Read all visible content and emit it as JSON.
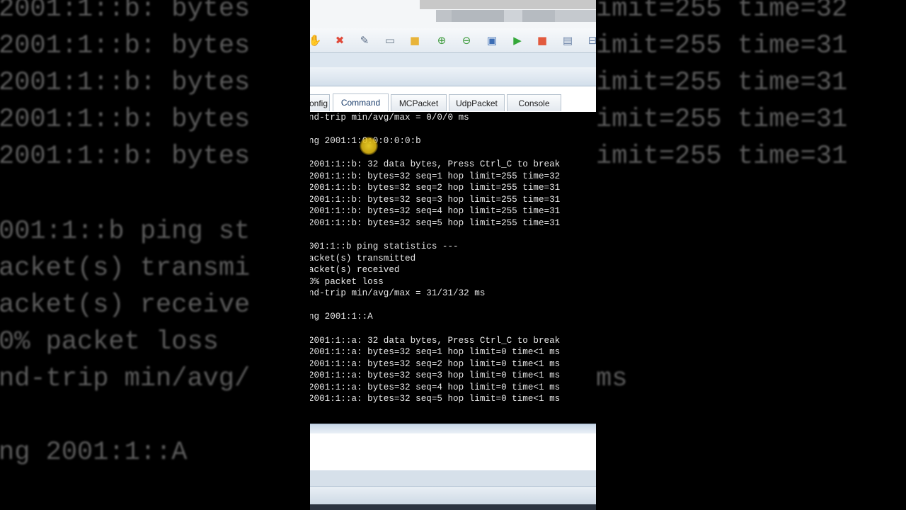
{
  "background": {
    "left_lines": [
      "2001:1::b: bytes",
      "2001:1::b: bytes",
      "2001:1::b: bytes",
      "2001:1::b: bytes",
      "2001:1::b: bytes",
      "",
      "001:1::b ping st",
      "acket(s) transmi",
      "acket(s) receive",
      "0% packet loss",
      "nd-trip min/avg/",
      "",
      "ng 2001:1::A"
    ],
    "right_lines": [
      "imit=255 time=32",
      "imit=255 time=31",
      "imit=255 time=31",
      "imit=255 time=31",
      "imit=255 time=31",
      "",
      "",
      "",
      "",
      "",
      "ms"
    ]
  },
  "toolbar": {
    "buttons": [
      {
        "name": "hand-icon",
        "glyph": "✋",
        "color": "#d98a2b"
      },
      {
        "name": "delete-icon",
        "glyph": "✖",
        "color": "#e04a3a"
      },
      {
        "name": "inspect-icon",
        "glyph": "✎",
        "color": "#5a6c86"
      },
      {
        "name": "note-icon",
        "glyph": "▭",
        "color": "#6a7a8a"
      },
      {
        "name": "draw-rectangle-icon",
        "glyph": "■",
        "color": "#e8b43a"
      },
      {
        "name": "zoom-in-icon",
        "glyph": "⊕",
        "color": "#3c9a3a"
      },
      {
        "name": "zoom-out-icon",
        "glyph": "⊖",
        "color": "#3c9a3a"
      },
      {
        "name": "fit-window-icon",
        "glyph": "▣",
        "color": "#3b6db5"
      },
      {
        "name": "start-device-icon",
        "glyph": "▶",
        "color": "#34a83a"
      },
      {
        "name": "stop-device-icon",
        "glyph": "■",
        "color": "#e25a3e"
      },
      {
        "name": "capture-icon",
        "glyph": "▤",
        "color": "#6c84a8"
      },
      {
        "name": "topology-icon",
        "glyph": "⊟",
        "color": "#6c84a8"
      }
    ]
  },
  "tabs": [
    {
      "label": "onfig"
    },
    {
      "label": "Command",
      "active": true
    },
    {
      "label": "MCPacket"
    },
    {
      "label": "UdpPacket"
    },
    {
      "label": "Console"
    }
  ],
  "console": {
    "lines": [
      "nd-trip min/avg/max = 0/0/0 ms",
      "",
      "ng 2001:1:0:0:0:0:0:b",
      "",
      "2001:1::b: 32 data bytes, Press Ctrl_C to break",
      "2001:1::b: bytes=32 seq=1 hop limit=255 time=32",
      "2001:1::b: bytes=32 seq=2 hop limit=255 time=31",
      "2001:1::b: bytes=32 seq=3 hop limit=255 time=31",
      "2001:1::b: bytes=32 seq=4 hop limit=255 time=31",
      "2001:1::b: bytes=32 seq=5 hop limit=255 time=31",
      "",
      "001:1::b ping statistics ---",
      "acket(s) transmitted",
      "acket(s) received",
      "0% packet loss",
      "nd-trip min/avg/max = 31/31/32 ms",
      "",
      "ng 2001:1::A",
      "",
      "2001:1::a: 32 data bytes, Press Ctrl_C to break",
      "2001:1::a: bytes=32 seq=1 hop limit=0 time<1 ms",
      "2001:1::a: bytes=32 seq=2 hop limit=0 time<1 ms",
      "2001:1::a: bytes=32 seq=3 hop limit=0 time<1 ms",
      "2001:1::a: bytes=32 seq=4 hop limit=0 time<1 ms",
      "2001:1::a: bytes=32 seq=5 hop limit=0 time<1 ms"
    ]
  }
}
